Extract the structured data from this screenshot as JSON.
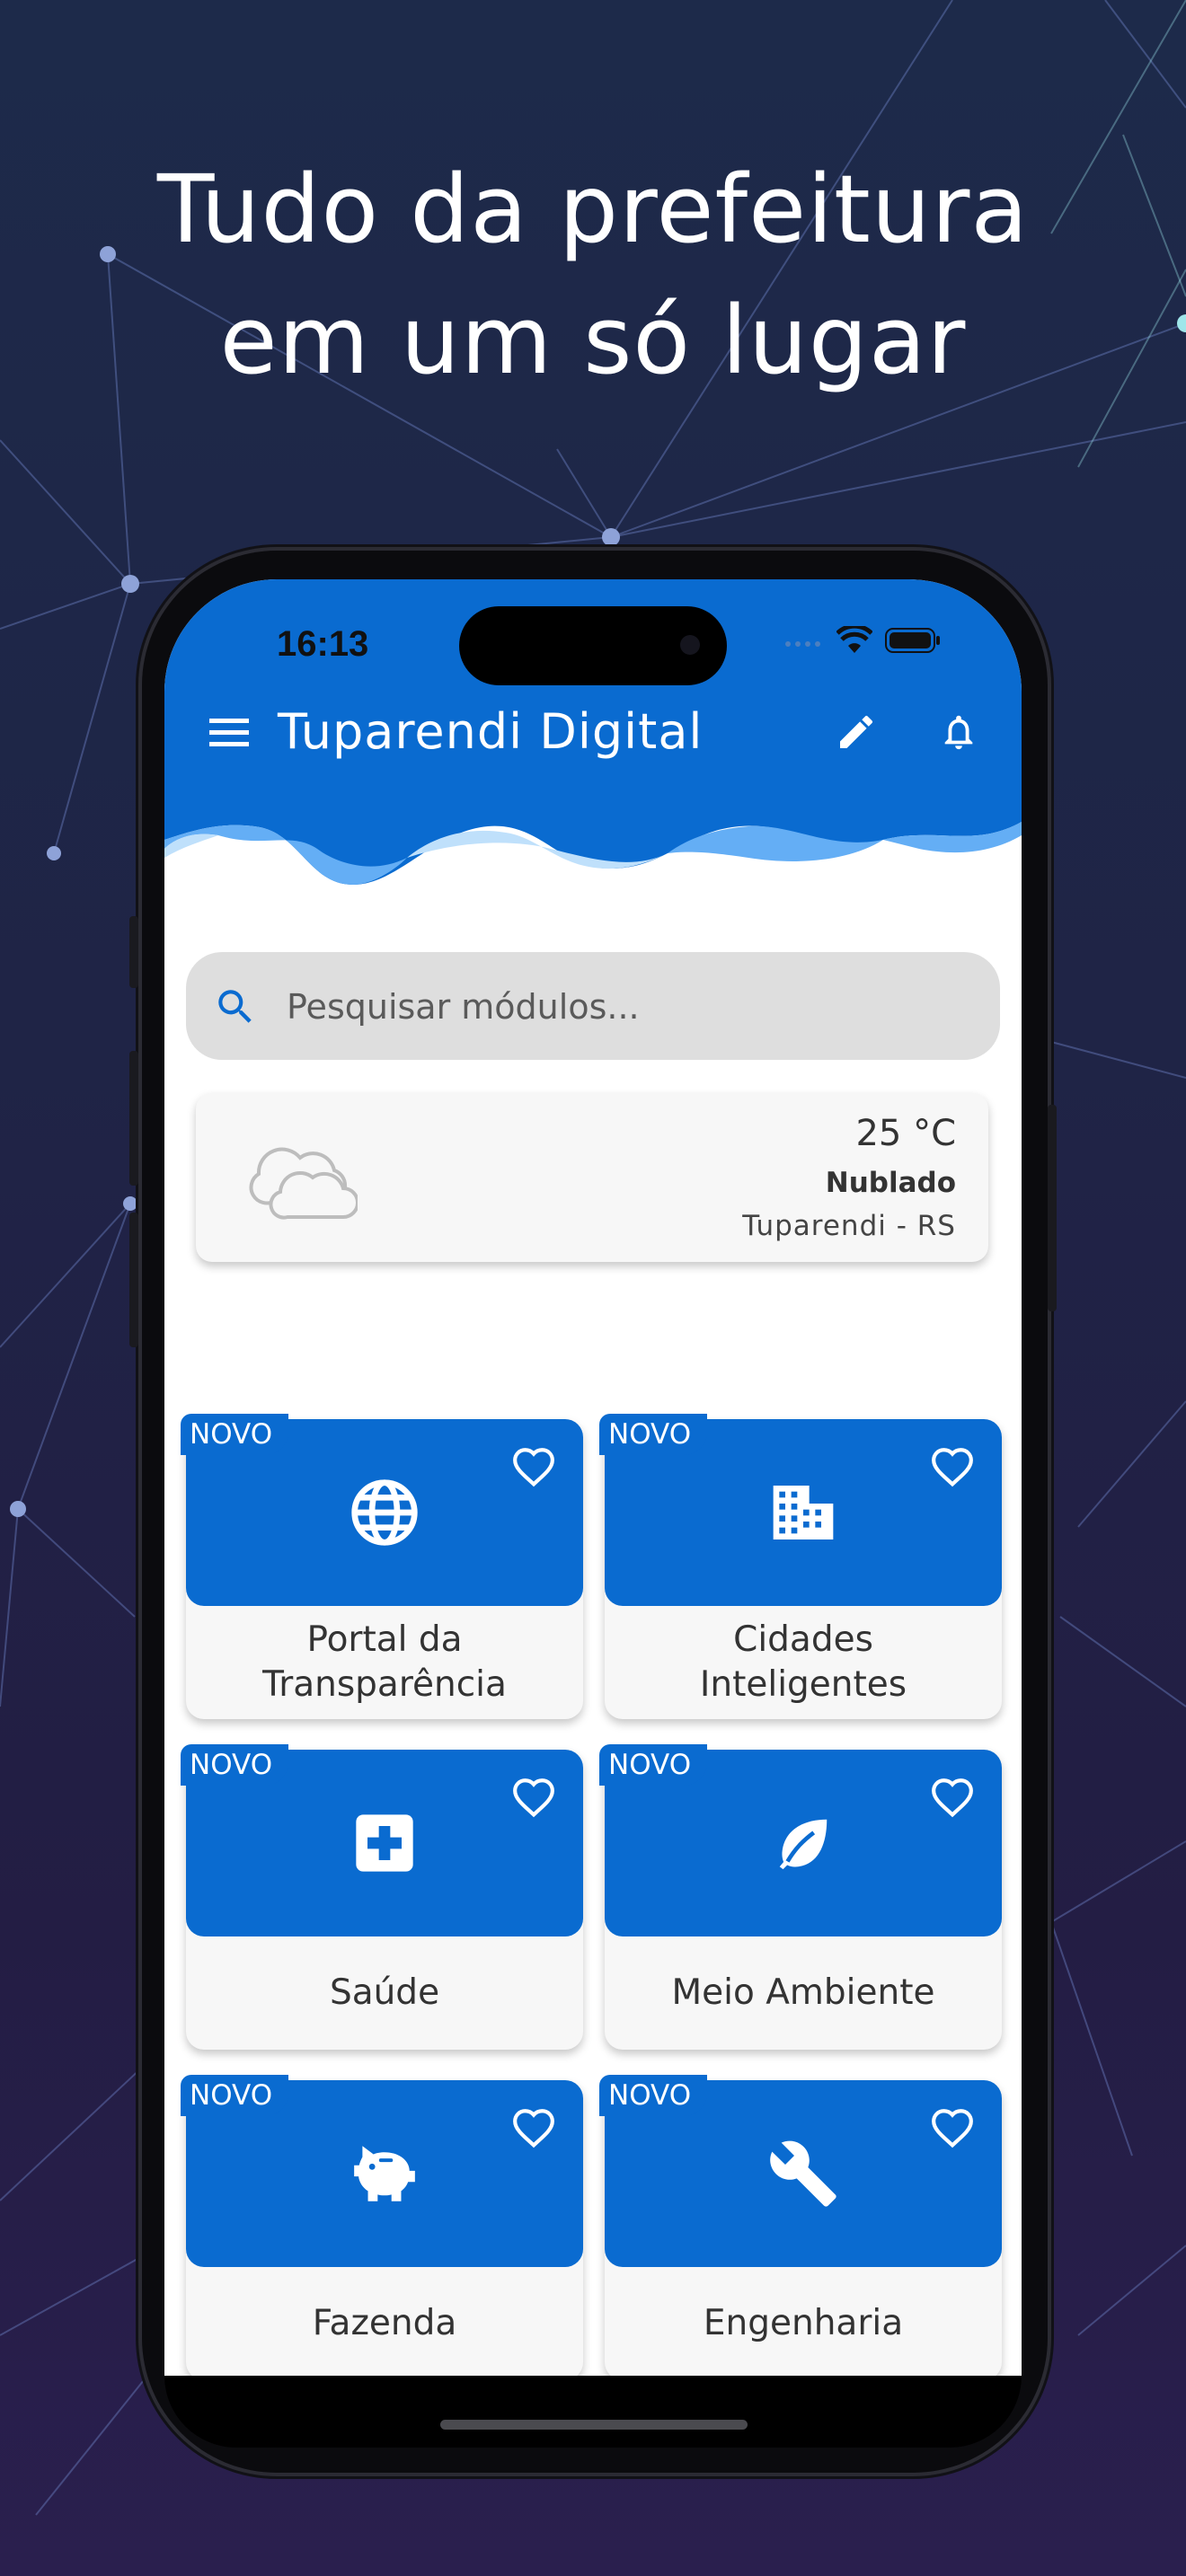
{
  "headline": {
    "line1": "Tudo da prefeitura",
    "line2": "em um só lugar"
  },
  "status_bar": {
    "time": "16:13"
  },
  "app_bar": {
    "title": "Tuparendi Digital",
    "menu_icon": "menu-icon",
    "edit_icon": "pencil-icon",
    "notifications_icon": "bell-icon"
  },
  "search": {
    "placeholder": "Pesquisar módulos..."
  },
  "weather": {
    "temperature": "25 °C",
    "condition": "Nublado",
    "location": "Tuparendi - RS",
    "icon": "cloud-icon"
  },
  "modules": [
    {
      "badge": "NOVO",
      "label": "Portal da\nTransparência",
      "icon": "globe-icon"
    },
    {
      "badge": "NOVO",
      "label": "Cidades\nInteligentes",
      "icon": "building-icon"
    },
    {
      "badge": "NOVO",
      "label": "Saúde",
      "icon": "medical-cross-icon"
    },
    {
      "badge": "NOVO",
      "label": "Meio Ambiente",
      "icon": "leaf-icon"
    },
    {
      "badge": "NOVO",
      "label": "Fazenda",
      "icon": "piggy-bank-icon"
    },
    {
      "badge": "NOVO",
      "label": "Engenharia",
      "icon": "wrench-icon"
    }
  ],
  "colors": {
    "primary": "#0a6bd0",
    "background": "#1f2446"
  }
}
